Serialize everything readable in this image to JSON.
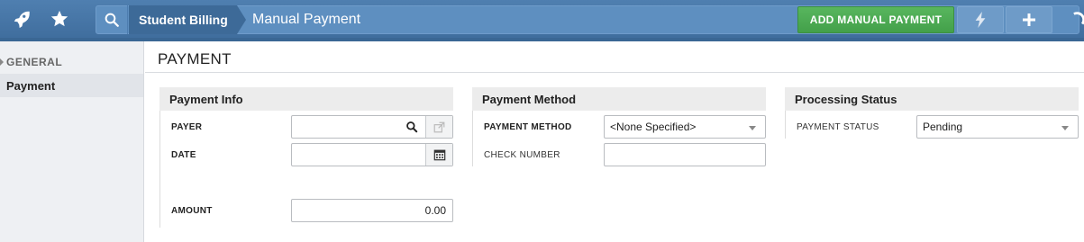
{
  "header": {
    "breadcrumb_root": "Student Billing",
    "breadcrumb_current": "Manual Payment",
    "add_button": "ADD MANUAL PAYMENT"
  },
  "sidebar": {
    "heading": "GENERAL",
    "items": [
      {
        "label": "Payment"
      }
    ]
  },
  "page": {
    "title": "PAYMENT"
  },
  "payment_info": {
    "title": "Payment Info",
    "payer_label": "PAYER",
    "payer_value": "",
    "date_label": "DATE",
    "date_value": "",
    "amount_label": "AMOUNT",
    "amount_value": "0.00"
  },
  "payment_method": {
    "title": "Payment Method",
    "method_label": "PAYMENT METHOD",
    "method_value": "<None Specified>",
    "check_label": "CHECK NUMBER",
    "check_value": ""
  },
  "processing_status": {
    "title": "Processing Status",
    "status_label": "PAYMENT STATUS",
    "status_value": "Pending"
  },
  "icons": [
    "rocket-icon",
    "star-icon",
    "search-icon",
    "lightning-icon",
    "plus-icon",
    "refresh-icon",
    "magnifier-icon",
    "external-link-icon",
    "calendar-icon"
  ],
  "colors": {
    "topbar": "#4a79a9",
    "accent_green": "#4caf50",
    "breadcrumb_active": "#3d6a98"
  }
}
